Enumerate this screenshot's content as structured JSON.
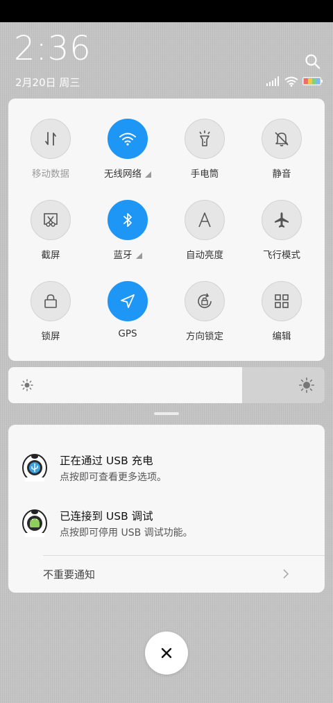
{
  "header": {
    "time": "2:36",
    "date": "2月20日 周三"
  },
  "icons": {
    "search": "search-icon",
    "signal": "signal-icon",
    "wifi": "wifi-icon",
    "battery": "battery-icon"
  },
  "colors": {
    "accent": "#1e96f5",
    "tile_off": "#e6e6e6",
    "card": "#f7f7f7"
  },
  "quick_settings": {
    "tiles": [
      {
        "label": "移动数据",
        "icon": "mobile-data-icon",
        "state": "disabled"
      },
      {
        "label": "无线网络",
        "icon": "wifi-icon",
        "state": "on"
      },
      {
        "label": "手电筒",
        "icon": "flashlight-icon",
        "state": "off"
      },
      {
        "label": "静音",
        "icon": "bell-off-icon",
        "state": "off"
      },
      {
        "label": "截屏",
        "icon": "screenshot-icon",
        "state": "off"
      },
      {
        "label": "蓝牙",
        "icon": "bluetooth-icon",
        "state": "on"
      },
      {
        "label": "自动亮度",
        "icon": "auto-brightness-icon",
        "state": "off"
      },
      {
        "label": "飞行模式",
        "icon": "airplane-icon",
        "state": "off"
      },
      {
        "label": "锁屏",
        "icon": "lock-icon",
        "state": "off"
      },
      {
        "label": "GPS",
        "icon": "location-arrow-icon",
        "state": "on"
      },
      {
        "label": "方向锁定",
        "icon": "rotation-lock-icon",
        "state": "off"
      },
      {
        "label": "编辑",
        "icon": "grid-icon",
        "state": "off"
      }
    ]
  },
  "brightness": {
    "level": 0.74
  },
  "notifications": [
    {
      "title": "正在通过 USB 充电",
      "text": "点按即可查看更多选项。",
      "icon": "usb-app-icon"
    },
    {
      "title": "已连接到 USB 调试",
      "text": "点按即可停用 USB 调试功能。",
      "icon": "android-debug-icon"
    }
  ],
  "minor_notifications": {
    "label": "不重要通知"
  }
}
